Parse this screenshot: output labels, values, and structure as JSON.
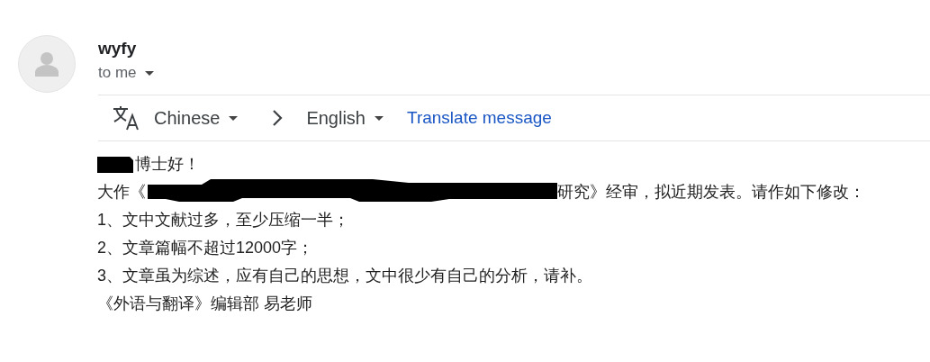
{
  "sender": {
    "name": "wyfy",
    "recipient": "to me"
  },
  "translate_bar": {
    "source_language": "Chinese",
    "target_language": "English",
    "action": "Translate message"
  },
  "body": [
    {
      "segments": [
        {
          "kind": "redaction"
        },
        {
          "kind": "text",
          "text": "博士好！"
        }
      ]
    },
    {
      "segments": [
        {
          "kind": "text",
          "text": "大作《"
        },
        {
          "kind": "redaction"
        },
        {
          "kind": "text",
          "text": "研究》经审，拟近期发表。请作如下修改："
        }
      ]
    },
    {
      "segments": [
        {
          "kind": "text",
          "text": "1、文中文献过多，至少压缩一半；"
        }
      ]
    },
    {
      "segments": [
        {
          "kind": "text",
          "text": "2、文章篇幅不超过12000字；"
        }
      ]
    },
    {
      "segments": [
        {
          "kind": "text",
          "text": "3、文章虽为综述，应有自己的思想，文中很少有自己的分析，请补。"
        }
      ]
    },
    {
      "segments": [
        {
          "kind": "text",
          "text": "《外语与翻译》编辑部 易老师"
        }
      ]
    }
  ]
}
